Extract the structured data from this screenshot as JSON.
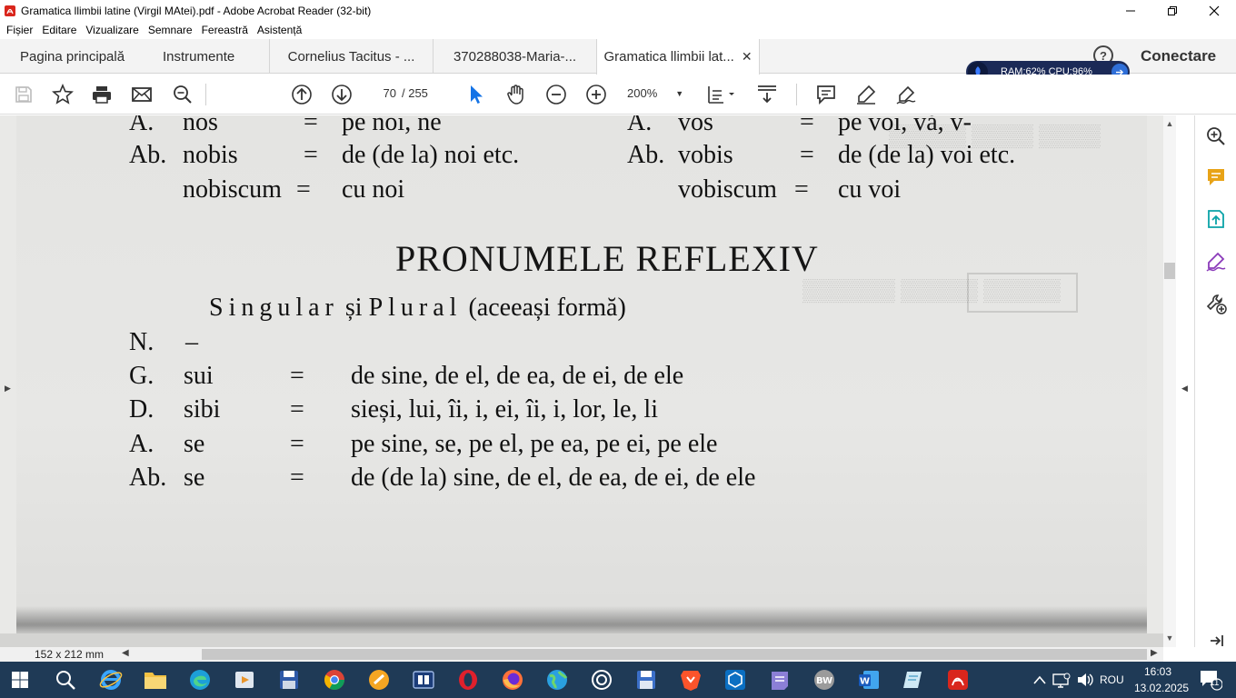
{
  "window": {
    "title": "Gramatica llimbii latine (Virgil MAtei).pdf - Adobe Acrobat Reader (32-bit)",
    "minimize_icon": "minimize-icon",
    "maximize_icon": "restore-icon",
    "close_icon": "close-icon"
  },
  "menu": [
    "Fișier",
    "Editare",
    "Vizualizare",
    "Semnare",
    "Fereastră",
    "Asistență"
  ],
  "tabs": {
    "home": "Pagina principală",
    "tools": "Instrumente",
    "documents": [
      {
        "label": "Cornelius Tacitus - ..."
      },
      {
        "label": "370288038-Maria-..."
      },
      {
        "label": "Gramatica llimbii lat...",
        "active": true
      }
    ],
    "signin": "Conectare"
  },
  "monitor": {
    "text": "RAM:62%  CPU:96%"
  },
  "toolbar": {
    "page_current": "70",
    "page_total": "/  255",
    "zoom": "200%"
  },
  "document": {
    "top_rows": [
      {
        "case": "A.",
        "lat": "nos",
        "eq": "=",
        "ro": "pe noi, ne",
        "case2": "A.",
        "lat2": "vos",
        "eq2": "=",
        "ro2": "pe voi, vă, v-"
      },
      {
        "case": "Ab.",
        "lat": "nobis",
        "eq": "=",
        "ro": "de (de la) noi etc.",
        "case2": "Ab.",
        "lat2": "vobis",
        "eq2": "=",
        "ro2": "de (de la) voi etc."
      },
      {
        "case": "",
        "lat": "nobiscum",
        "eq": "=",
        "ro": "cu noi",
        "case2": "",
        "lat2": "vobiscum",
        "eq2": "=",
        "ro2": "cu voi"
      }
    ],
    "heading": "PRONUMELE REFLEXIV",
    "subheading_spaced_1": "Singular",
    "subheading_mid": "și",
    "subheading_spaced_2": "Plural",
    "subheading_rest": "(aceeași formă)",
    "rows": [
      {
        "case": "N.",
        "lat": "–",
        "eq": "",
        "ro": ""
      },
      {
        "case": "G.",
        "lat": "sui",
        "eq": "=",
        "ro": "de sine, de el, de ea, de ei, de ele"
      },
      {
        "case": "D.",
        "lat": "sibi",
        "eq": "=",
        "ro": "sieși, lui, îi, i, ei, îi, i, lor, le, li"
      },
      {
        "case": "A.",
        "lat": "se",
        "eq": "=",
        "ro": "pe sine, se, pe el, pe ea, pe ei, pe ele"
      },
      {
        "case": "Ab.",
        "lat": "se",
        "eq": "=",
        "ro": "de (de la) sine, de el, de ea, de ei, de ele"
      }
    ]
  },
  "status": {
    "page_size": "152 x 212 mm"
  },
  "tray": {
    "language": "ROU",
    "time": "16:03",
    "date": "13.02.2025",
    "notifications": "11"
  },
  "colors": {
    "acrobat_red": "#d9261c",
    "taskbar": "#1f3a56",
    "monitor_bg": "#1b2a57",
    "accent_blue": "#1473e6"
  }
}
